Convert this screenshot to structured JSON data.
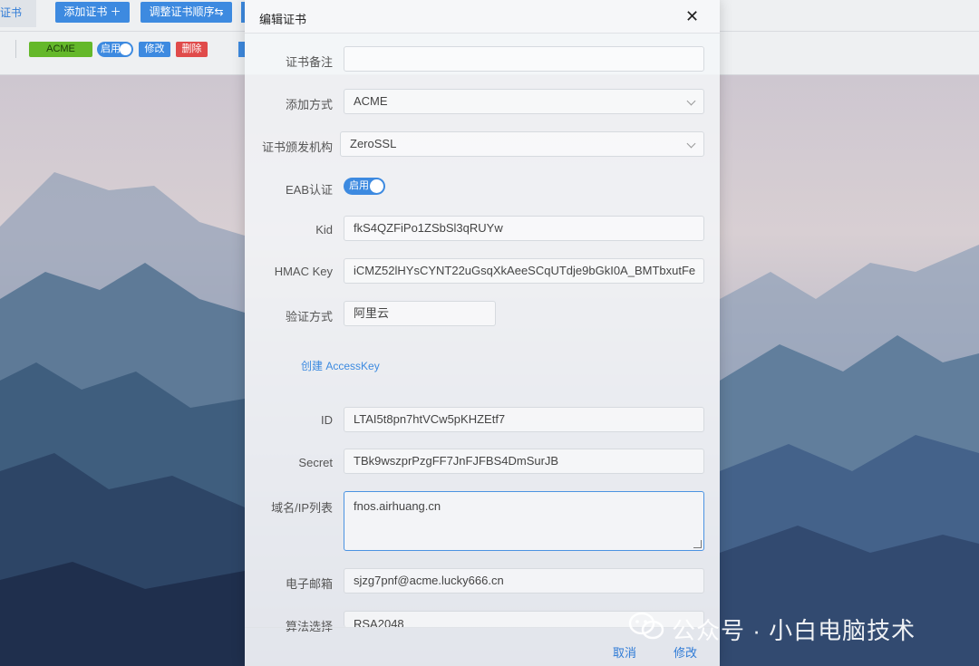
{
  "topbar": {
    "active_tab": "证书",
    "add_cert_label": "添加证书 ＋",
    "reorder_label": "调整证书顺序⇆",
    "row": {
      "type_chip": "ACME",
      "enabled_label": "启用",
      "edit_label": "修改",
      "delete_label": "删除"
    }
  },
  "modal": {
    "title": "编辑证书",
    "close": "✕",
    "fields": {
      "remark": {
        "label": "证书备注",
        "value": ""
      },
      "add_method": {
        "label": "添加方式",
        "value": "ACME"
      },
      "issuer": {
        "label": "证书颁发机构",
        "value": "ZeroSSL"
      },
      "eab": {
        "label": "EAB认证",
        "toggle_text": "启用",
        "enabled": true
      },
      "kid": {
        "label": "Kid",
        "value": "fkS4QZFiPo1ZSbSl3qRUYw"
      },
      "hmac": {
        "label": "HMAC Key",
        "value": "iCMZ52lHYsCYNT22uGsqXkAeeSCqUTdje9bGkI0A_BMTbxutFe"
      },
      "verify": {
        "label": "验证方式",
        "value": "阿里云"
      },
      "create_key_link": "创建 AccessKey",
      "id": {
        "label": "ID",
        "value": "LTAI5t8pn7htVCw5pKHZEtf7"
      },
      "secret": {
        "label": "Secret",
        "value": "TBk9wszprPzgFF7JnFJFBS4DmSurJB"
      },
      "domains": {
        "label": "域名/IP列表",
        "value": "fnos.airhuang.cn"
      },
      "email": {
        "label": "电子邮箱",
        "value": "sjzg7pnf@acme.lucky666.cn"
      },
      "algo": {
        "label": "算法选择",
        "value": "RSA2048"
      }
    },
    "footer": {
      "cancel": "取消",
      "confirm": "修改"
    }
  },
  "watermark": {
    "text": "公众号 · 小白电脑技术"
  },
  "colors": {
    "accent": "#3d8ae0",
    "chip_green": "#64b82a",
    "danger": "#e04b4b"
  }
}
